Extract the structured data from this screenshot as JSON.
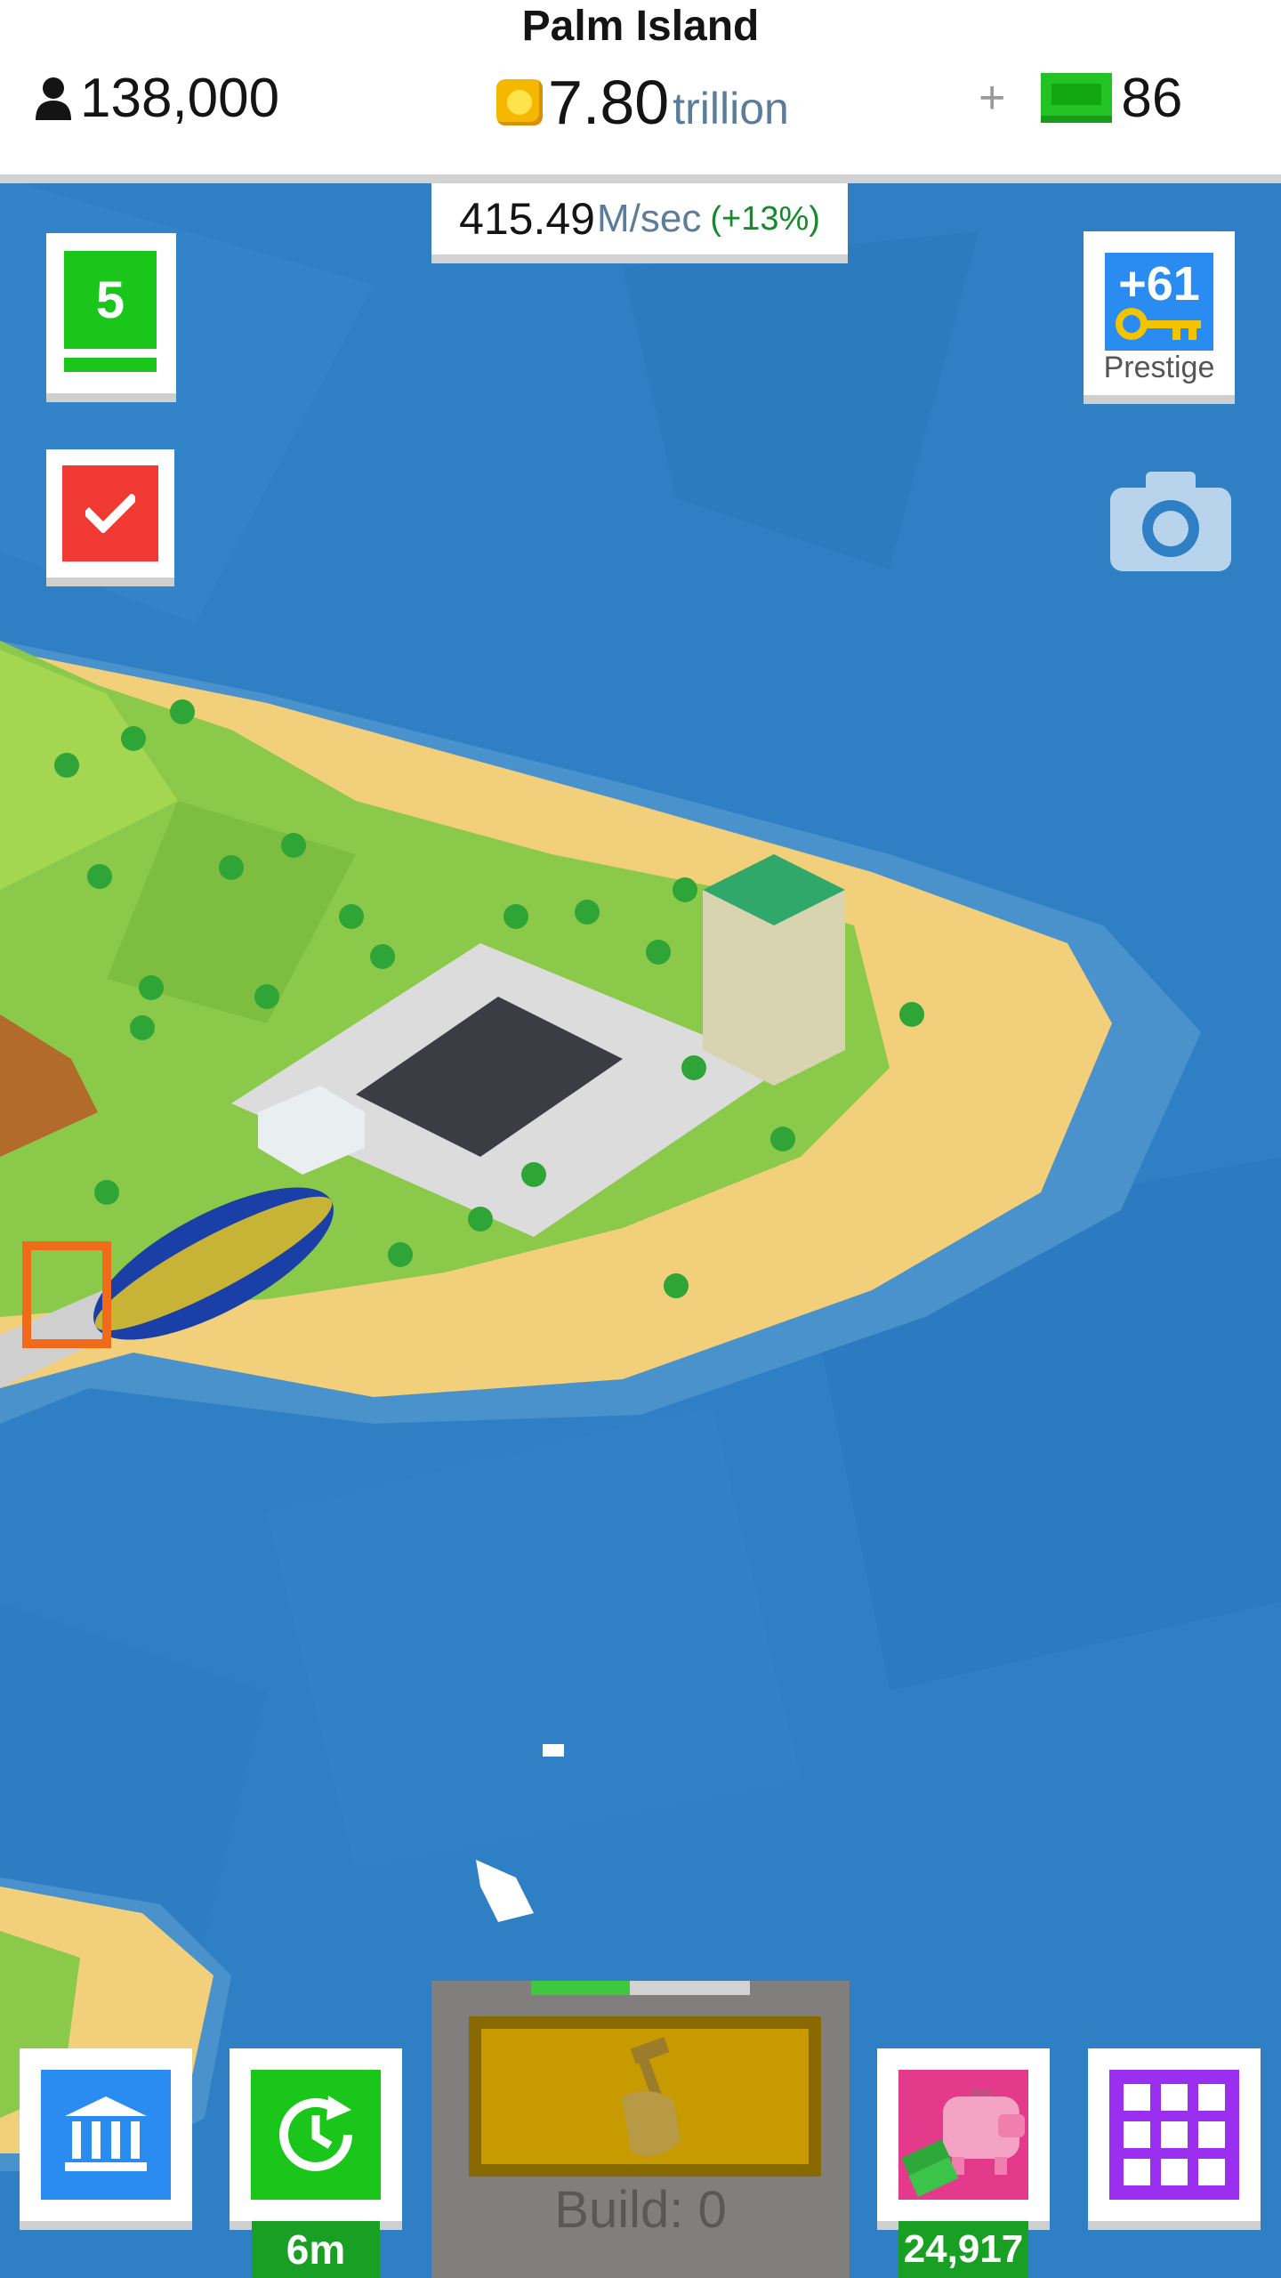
{
  "header": {
    "island_name": "Palm Island",
    "population": "138,000",
    "cash_value": "7.80",
    "cash_unit": "trillion",
    "gems_plus": "+",
    "gems": "86"
  },
  "income": {
    "rate_value": "415.49",
    "rate_unit": "M/sec",
    "rate_bonus": "(+13%)"
  },
  "left_buttons": {
    "level": "5"
  },
  "prestige": {
    "keys": "+61",
    "label": "Prestige"
  },
  "bottom_bar": {
    "boost_time": "6m",
    "build_label": "Build: 0",
    "build_progress": 0.45,
    "piggy_bank_value": "24,917"
  },
  "colors": {
    "ocean": "#2f7fc4",
    "sand": "#f2cf7a",
    "grass": "#8bc94a",
    "level_green": "#19c619",
    "check_red": "#f13a33",
    "prestige_blue": "#2a8cf0",
    "piggy_pink": "#e33a8b",
    "menu_purple": "#9b2ff0"
  },
  "icons": [
    "person-icon",
    "coin-icon",
    "gem-icon",
    "check-icon",
    "key-icon",
    "camera-icon",
    "bank-icon",
    "clock-refresh-icon",
    "hammer-hand-icon",
    "piggy-bank-icon",
    "grid-menu-icon"
  ]
}
